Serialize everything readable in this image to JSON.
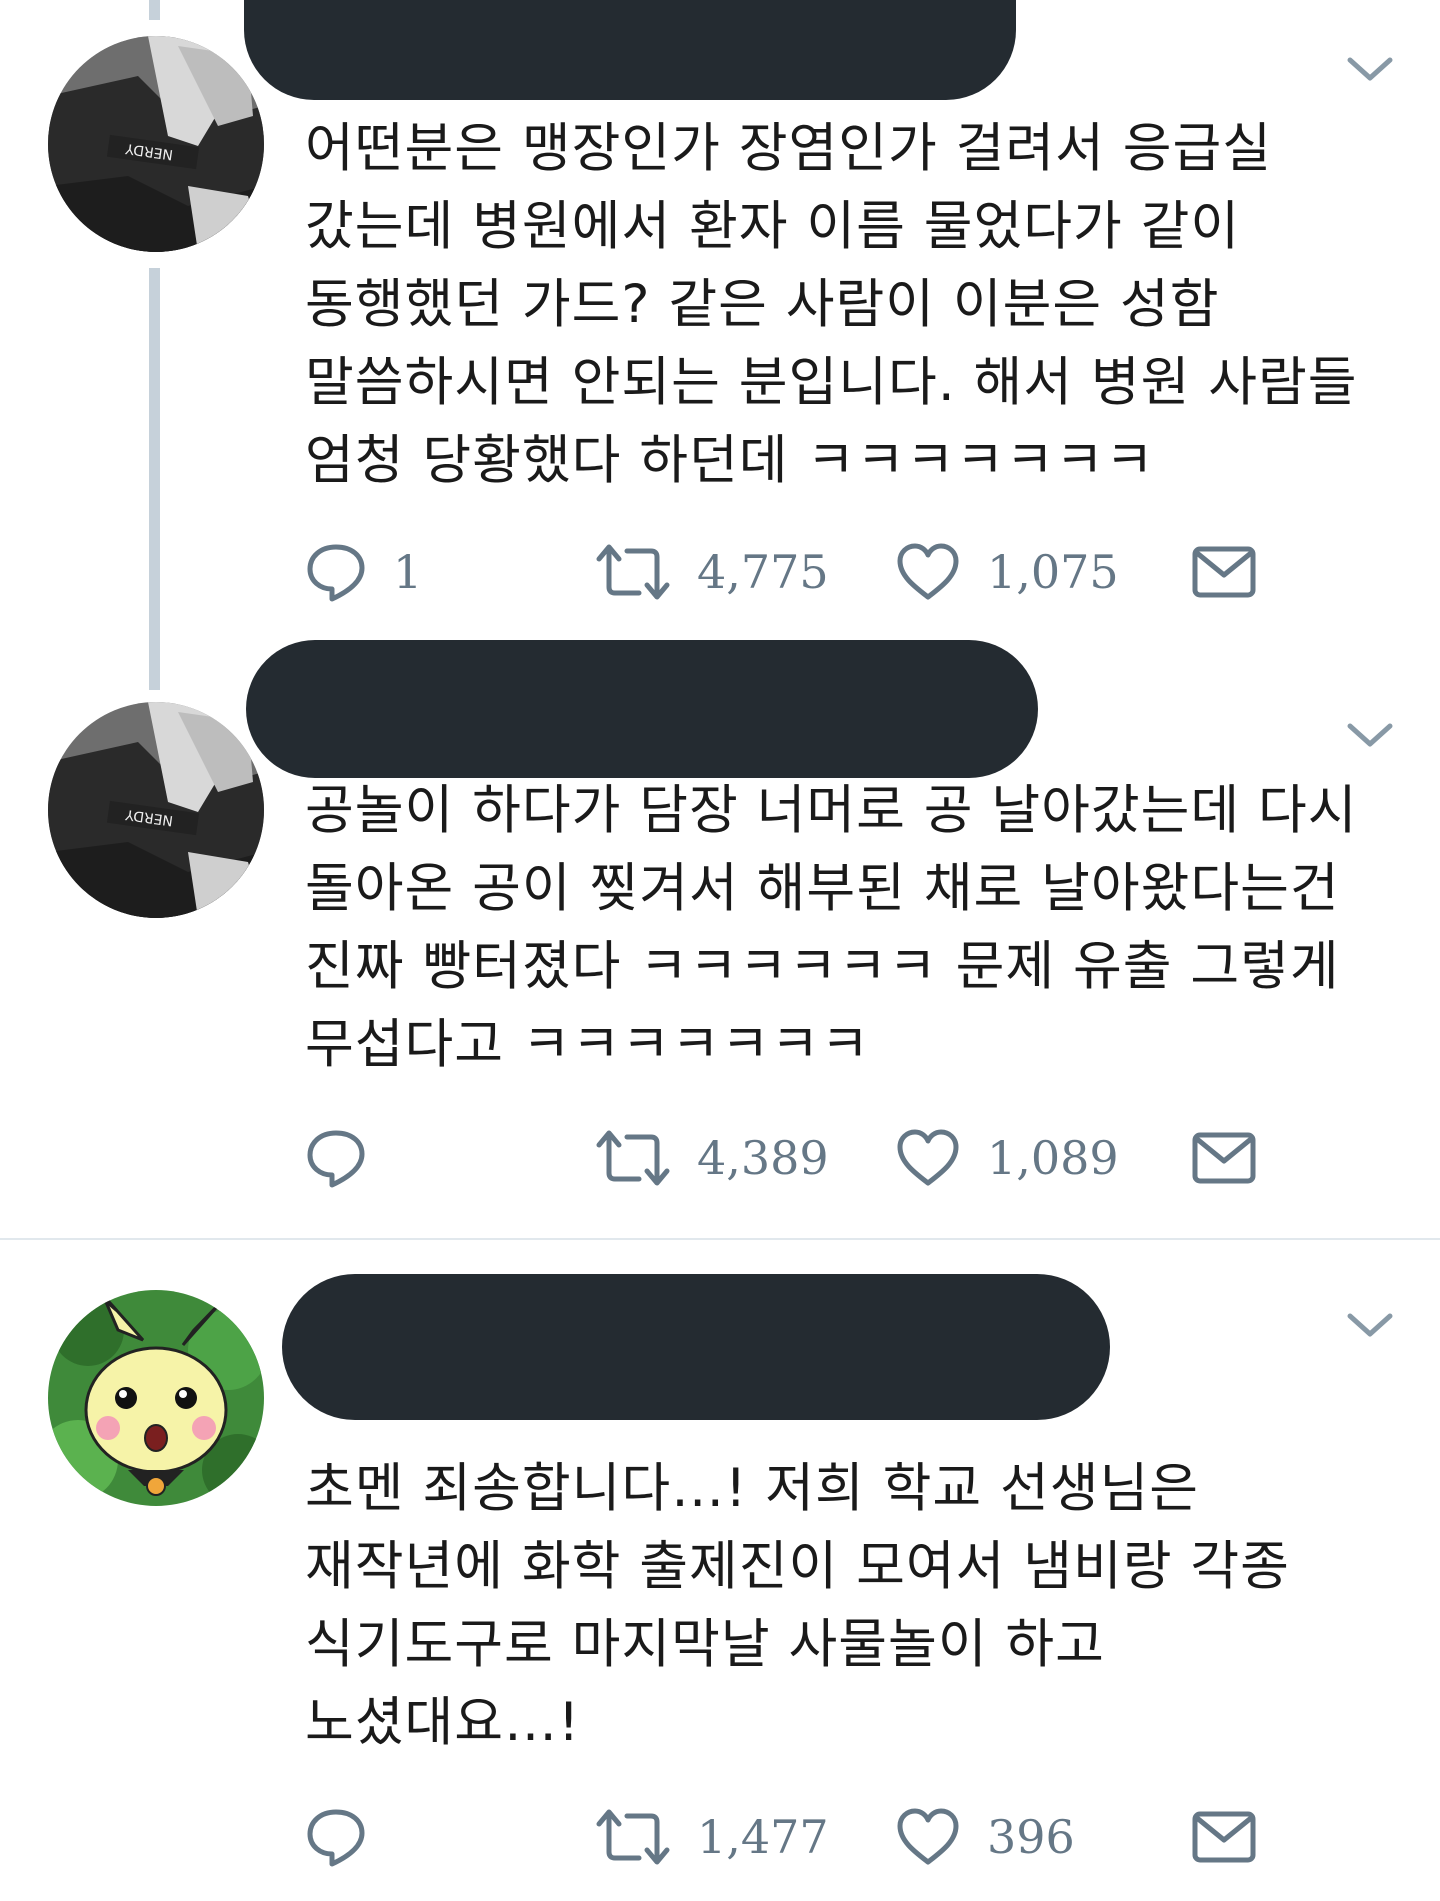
{
  "tweets": [
    {
      "text": "어떤분은 맹장인가 장염인가 걸려서 응급실\n갔는데 병원에서 환자 이름 물었다가 같이\n동행했던 가드? 같은 사람이 이분은 성함\n말씀하시면 안되는 분입니다. 해서 병원 사람들\n엄청 당황했다 하던데 ㅋㅋㅋㅋㅋㅋㅋ",
      "reply_count": "1",
      "retweet_count": "4,775",
      "like_count": "1,075"
    },
    {
      "text": "공놀이 하다가 담장 너머로 공 날아갔는데 다시\n돌아온 공이 찢겨서 해부된 채로 날아왔다는건\n진짜 빵터졌다 ㅋㅋㅋㅋㅋㅋ 문제 유출 그렇게\n무섭다고 ㅋㅋㅋㅋㅋㅋㅋ",
      "reply_count": "",
      "retweet_count": "4,389",
      "like_count": "1,089"
    },
    {
      "text": "초멘 죄송합니다…! 저희 학교 선생님은\n재작년에 화학 출제진이 모여서 냄비랑 각종\n식기도구로 마지막날 사물놀이 하고\n노셨대요…!",
      "reply_count": "",
      "retweet_count": "1,477",
      "like_count": "396"
    }
  ],
  "icons": {
    "reply": "reply-icon",
    "retweet": "retweet-icon",
    "like": "heart-icon",
    "dm": "envelope-icon",
    "menu": "chevron-down-icon"
  },
  "colors": {
    "icon": "#657786",
    "redaction": "#242b31",
    "thread_line": "#c6d1da",
    "divider": "#e1e8ed"
  }
}
